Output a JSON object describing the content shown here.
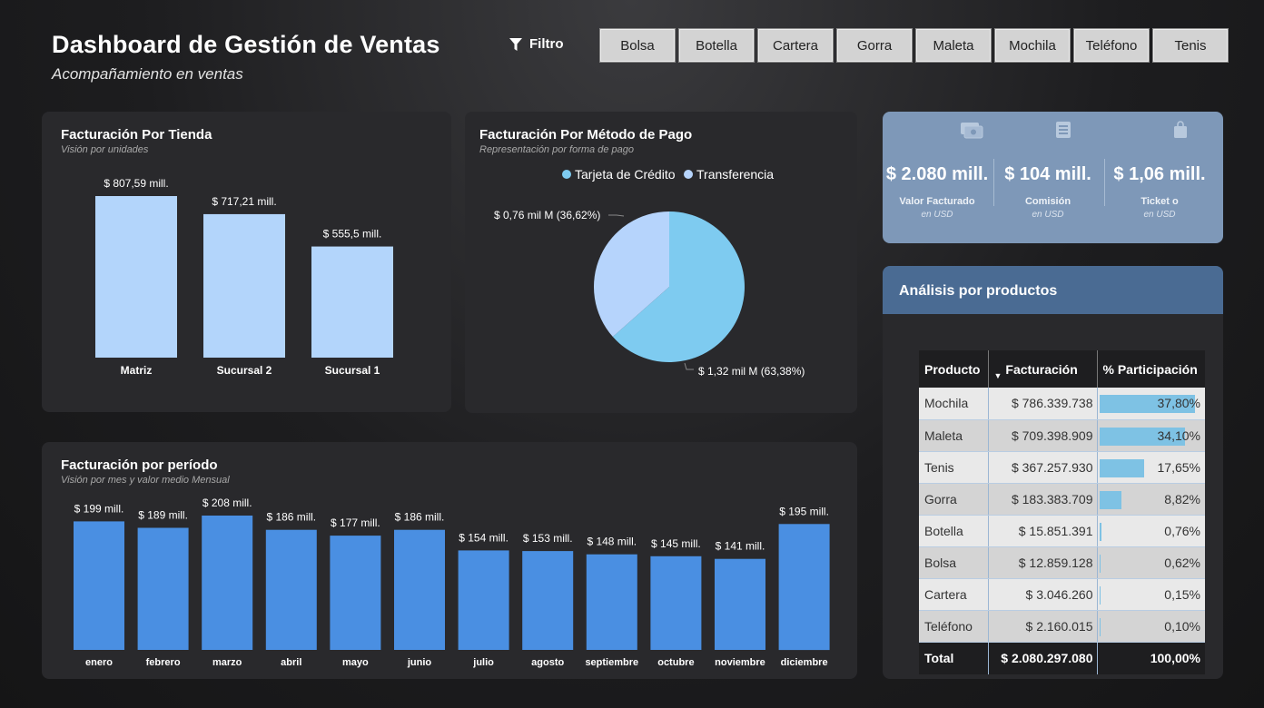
{
  "header": {
    "title": "Dashboard de Gestión de Ventas",
    "subtitle": "Acompañamiento en ventas",
    "filter_label": "Filtro"
  },
  "slicer": [
    "Bolsa",
    "Botella",
    "Cartera",
    "Gorra",
    "Maleta",
    "Mochila",
    "Teléfono",
    "Tenis"
  ],
  "panels": {
    "store": {
      "title": "Facturación Por Tienda",
      "subtitle": "Visión por unidades"
    },
    "payment": {
      "title": "Facturación Por Método de Pago",
      "subtitle": "Representación por forma de pago"
    },
    "period": {
      "title": "Facturación por período",
      "subtitle": "Visión por mes y valor medio Mensual"
    }
  },
  "kpis": [
    {
      "value": "$ 2.080 mill.",
      "label": "Valor Facturado",
      "unit": "en USD",
      "icon": "money-icon"
    },
    {
      "value": "$ 104 mill.",
      "label": "Comisión",
      "unit": "en USD",
      "icon": "document-icon"
    },
    {
      "value": "$ 1,06 mill.",
      "label": "Ticket o",
      "unit": "en USD",
      "icon": "shopping-bag-icon"
    }
  ],
  "products": {
    "title": "Análisis por productos",
    "headers": [
      "Producto",
      "Facturación",
      "% Participación"
    ],
    "rows": [
      {
        "producto": "Mochila",
        "facturacion": "$ 786.339.738",
        "participacion": "37,80%",
        "pct": 37.8
      },
      {
        "producto": "Maleta",
        "facturacion": "$ 709.398.909",
        "participacion": "34,10%",
        "pct": 34.1
      },
      {
        "producto": "Tenis",
        "facturacion": "$ 367.257.930",
        "participacion": "17,65%",
        "pct": 17.65
      },
      {
        "producto": "Gorra",
        "facturacion": "$ 183.383.709",
        "participacion": "8,82%",
        "pct": 8.82
      },
      {
        "producto": "Botella",
        "facturacion": "$ 15.851.391",
        "participacion": "0,76%",
        "pct": 0.76
      },
      {
        "producto": "Bolsa",
        "facturacion": "$ 12.859.128",
        "participacion": "0,62%",
        "pct": 0.62
      },
      {
        "producto": "Cartera",
        "facturacion": "$ 3.046.260",
        "participacion": "0,15%",
        "pct": 0.15
      },
      {
        "producto": "Teléfono",
        "facturacion": "$ 2.160.015",
        "participacion": "0,10%",
        "pct": 0.1
      }
    ],
    "total": {
      "label": "Total",
      "facturacion": "$ 2.080.297.080",
      "participacion": "100,00%"
    }
  },
  "colors": {
    "store_bar": "#b3d5fb",
    "month_bar": "#4a8fe2",
    "pie_credit": "#7ecbf0",
    "pie_transfer": "#b6d4fc",
    "kpi_bg": "#7e98b8",
    "product_header": "#4a6b93"
  },
  "chart_data": [
    {
      "type": "bar",
      "title": "Facturación Por Tienda",
      "categories": [
        "Matriz",
        "Sucursal 2",
        "Sucursal 1"
      ],
      "values": [
        807.59,
        717.21,
        555.5
      ],
      "data_labels": [
        "$ 807,59 mill.",
        "$ 717,21 mill.",
        "$ 555,5 mill."
      ],
      "ylim": [
        0,
        807.59
      ]
    },
    {
      "type": "pie",
      "title": "Facturación Por Método de Pago",
      "legend": [
        "Tarjeta de Crédito",
        "Transferencia"
      ],
      "values": [
        1.32,
        0.76
      ],
      "percent": [
        63.38,
        36.62
      ],
      "data_labels": [
        "$ 1,32 mil M (63,38%)",
        "$ 0,76 mil M (36,62%)"
      ],
      "legend_position": "top"
    },
    {
      "type": "bar",
      "title": "Facturación por período",
      "categories": [
        "enero",
        "febrero",
        "marzo",
        "abril",
        "mayo",
        "junio",
        "julio",
        "agosto",
        "septiembre",
        "octubre",
        "noviembre",
        "diciembre"
      ],
      "values": [
        199,
        189,
        208,
        186,
        177,
        186,
        154,
        153,
        148,
        145,
        141,
        195
      ],
      "data_labels": [
        "$ 199 mill.",
        "$ 189 mill.",
        "$ 208 mill.",
        "$ 186 mill.",
        "$ 177 mill.",
        "$ 186 mill.",
        "$ 154 mill.",
        "$ 153 mill.",
        "$ 148 mill.",
        "$ 145 mill.",
        "$ 141 mill.",
        "$ 195 mill."
      ],
      "ylim": [
        0,
        208
      ]
    }
  ]
}
